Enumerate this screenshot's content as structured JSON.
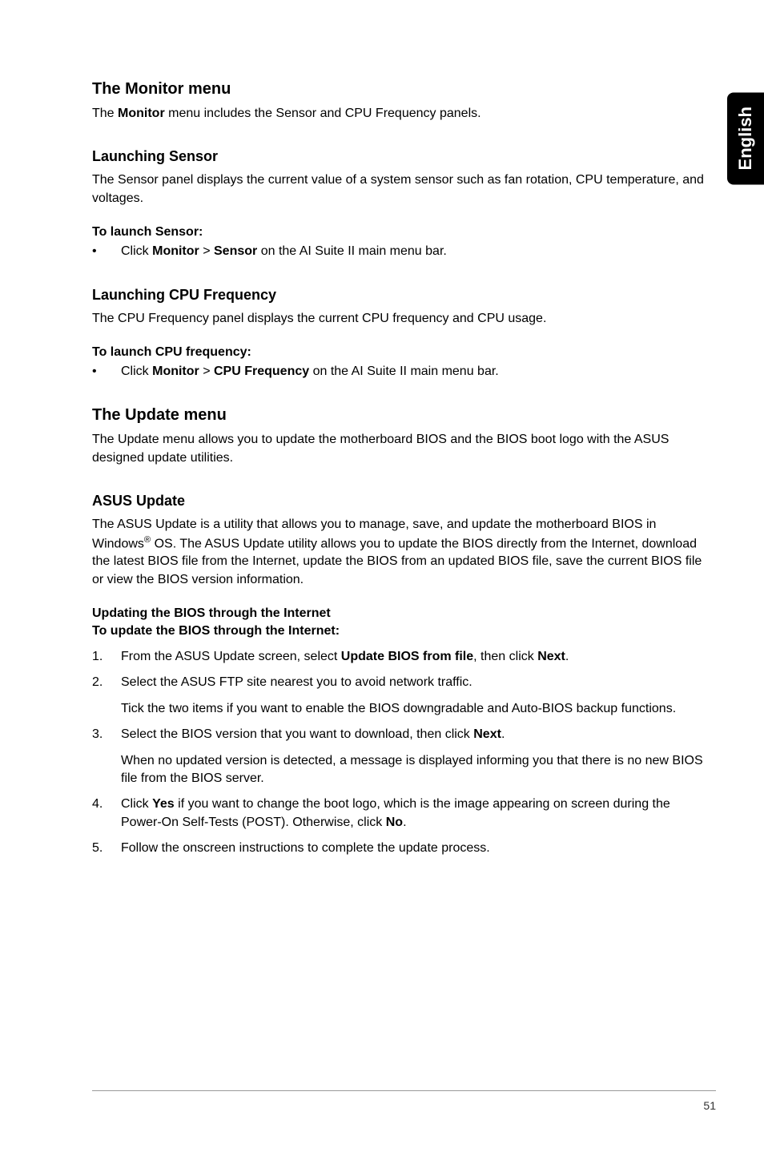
{
  "side_tab": "English",
  "s1": {
    "title": "The Monitor menu",
    "intro_a": "The ",
    "intro_b": "Monitor",
    "intro_c": " menu includes the Sensor and CPU Frequency panels.",
    "sensor": {
      "title": "Launching Sensor",
      "desc": "The Sensor panel displays the current value of a system sensor such as fan rotation, CPU temperature, and voltages.",
      "to_launch": "To launch Sensor:",
      "bullet_a": "Click ",
      "bullet_b": "Monitor",
      "bullet_c": " > ",
      "bullet_d": "Sensor",
      "bullet_e": " on the AI Suite II main menu bar."
    },
    "cpu": {
      "title": "Launching CPU Frequency",
      "desc": "The CPU Frequency panel displays the current CPU frequency and CPU usage.",
      "to_launch": "To launch CPU frequency:",
      "bullet_a": "Click ",
      "bullet_b": "Monitor",
      "bullet_c": " > ",
      "bullet_d": "CPU Frequency",
      "bullet_e": " on the AI Suite II main menu bar."
    }
  },
  "s2": {
    "title": "The Update menu",
    "desc": "The Update menu allows you to update the motherboard BIOS and the BIOS boot logo with the ASUS designed update utilities.",
    "asus": {
      "title": "ASUS Update",
      "desc_a": "The ASUS Update is a utility that allows you to manage, save, and update the motherboard BIOS in Windows",
      "desc_sup": "®",
      "desc_b": " OS. The ASUS Update utility allows you to update the BIOS directly from the Internet, download the latest BIOS file from the Internet, update the BIOS from an updated BIOS file, save the current BIOS file or view the BIOS version information.",
      "h_internet": "Updating the BIOS through the Internet",
      "h_to_update": "To update the BIOS through the Internet:",
      "ol": {
        "n1": "1.",
        "n2": "2.",
        "n3": "3.",
        "n4": "4.",
        "n5": "5.",
        "i1_a": "From the ASUS Update screen, select ",
        "i1_b": "Update BIOS from file",
        "i1_c": ", then click ",
        "i1_d": "Next",
        "i1_e": ".",
        "i2": "Select the ASUS FTP site nearest you to avoid network traffic.",
        "i2_sub": "Tick the two items if you want to enable the BIOS downgradable and Auto-BIOS backup functions.",
        "i3_a": "Select the BIOS version that you want to download, then click ",
        "i3_b": "Next",
        "i3_c": ".",
        "i3_sub": "When no updated version is detected, a message is displayed informing you that there is no new BIOS file from the BIOS server.",
        "i4_a": "Click ",
        "i4_b": "Yes",
        "i4_c": " if you want to change the boot logo, which is the image appearing on screen during the Power-On Self-Tests (POST). Otherwise, click ",
        "i4_d": "No",
        "i4_e": ".",
        "i5": "Follow the onscreen instructions to complete the update process."
      }
    }
  },
  "page_number": "51"
}
